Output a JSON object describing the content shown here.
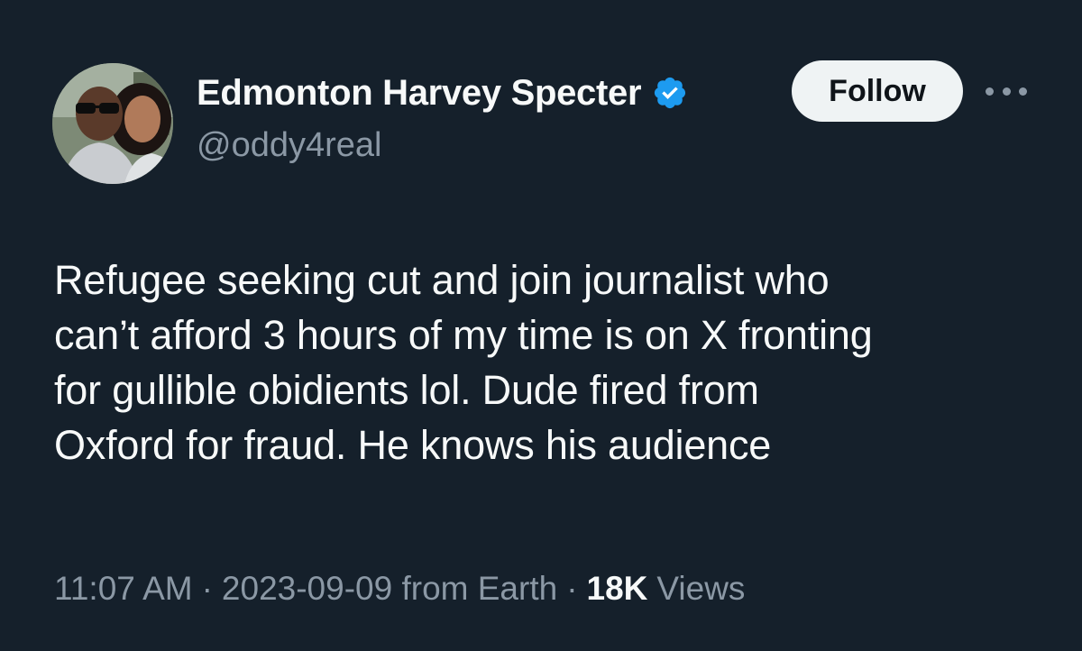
{
  "author": {
    "display_name": "Edmonton Harvey Specter",
    "handle": "@oddy4real",
    "avatar_icon": "profile-photo",
    "verified_icon": "verified-badge-icon",
    "verified_color": "#1d9bf0"
  },
  "actions": {
    "follow_label": "Follow",
    "more_icon": "more-options-icon"
  },
  "tweet": {
    "lines": [
      "Refugee seeking cut and join journalist who",
      "can’t afford 3 hours of my time is on X fronting",
      "for gullible obidients lol. Dude fired from",
      "Oxford for fraud. He knows his audience"
    ]
  },
  "meta": {
    "time": "11:07 AM",
    "date_source": "2023-09-09 from Earth",
    "separator": "·",
    "views_count": "18K",
    "views_label": "Views"
  },
  "colors": {
    "background": "#15202b",
    "primary_text": "#f7f9f9",
    "secondary_text": "#8b98a5",
    "follow_bg": "#eff3f4"
  }
}
